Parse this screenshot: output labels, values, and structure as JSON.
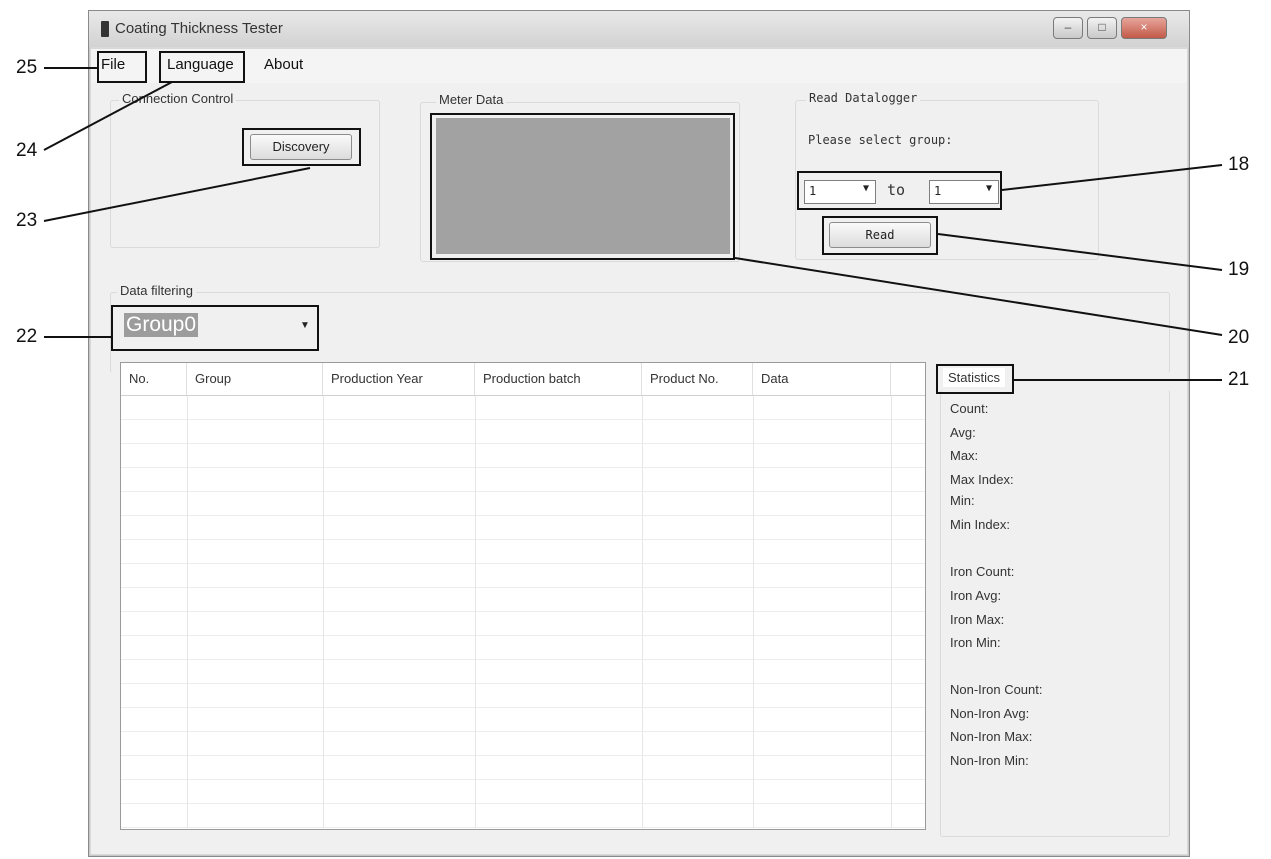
{
  "window": {
    "title": "Coating Thickness Tester",
    "minimize": "–",
    "maximize": "□",
    "close": "×"
  },
  "menu": {
    "file": "File",
    "language": "Language",
    "about": "About"
  },
  "connection": {
    "title": "Connection Control",
    "discovery_label": "Discovery"
  },
  "meter": {
    "title": "Meter Data"
  },
  "datalogger": {
    "title": "Read Datalogger",
    "prompt": "Please select group:",
    "from_value": "1",
    "to_label": "to",
    "to_value": "1",
    "read_label": "Read"
  },
  "filter": {
    "title": "Data filtering",
    "selected": "Group0"
  },
  "table": {
    "columns": [
      "No.",
      "Group",
      "Production Year",
      "Production batch",
      "Product No.",
      "Data"
    ]
  },
  "statistics": {
    "title": "Statistics",
    "labels": [
      "Count:",
      "Avg:",
      "Max:",
      "Max Index:",
      "Min:",
      "Min Index:",
      "Iron Count:",
      "Iron Avg:",
      "Iron Max:",
      "Iron Min:",
      "Non-Iron Count:",
      "Non-Iron Avg:",
      "Non-Iron Max:",
      "Non-Iron Min:"
    ]
  },
  "callouts": [
    "25",
    "24",
    "23",
    "22",
    "18",
    "19",
    "20",
    "21"
  ]
}
